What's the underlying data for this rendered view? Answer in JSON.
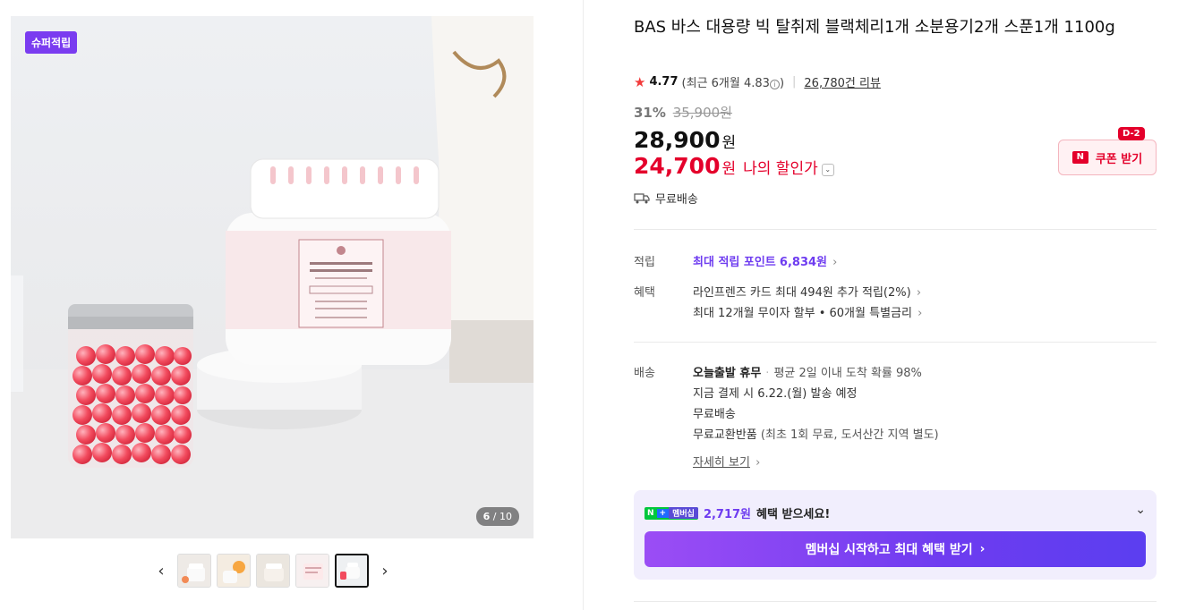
{
  "gallery": {
    "badge": "슈퍼적립",
    "counter_current": "6",
    "counter_total": "/ 10",
    "thumbs_count": 5,
    "prev_icon": "chevron-left-icon",
    "next_icon": "chevron-right-icon"
  },
  "product": {
    "title": "BAS 바스 대용량 빅 탈취제 블랙체리1개 소분용기2개 스푼1개 1100g",
    "rating": {
      "score": "4.77",
      "recent": "(최근 6개월 4.83",
      "recent_close": ")",
      "reviews": "26,780건 리뷰"
    },
    "discount_rate": "31%",
    "original_price": "35,900원",
    "price": "28,900",
    "price_unit": "원",
    "my_price": "24,700",
    "my_price_unit": "원",
    "my_price_label": "나의 할인가",
    "shipping": "무료배송"
  },
  "coupon": {
    "label": "쿠폰 받기",
    "dday": "D-2",
    "logo": "N"
  },
  "points": {
    "label": "적립",
    "text": "최대 적립 포인트",
    "amount": "6,834원"
  },
  "benefits": {
    "label": "혜택",
    "line1": "라인프렌즈 카드 최대 494원 추가 적립(2%)",
    "line2": "최대 12개월 무이자 할부 • 60개월 특별금리"
  },
  "delivery": {
    "label": "배송",
    "today_title": "오늘출발 휴무",
    "today_sub": "평균 2일 이내 도착 확률 98%",
    "schedule": "지금 결제 시 6.22.(월) 발송 예정",
    "free": "무료배송",
    "exchange": "무료교환반품",
    "exchange_sub": "(최초 1회 무료, 도서산간 지역 별도)",
    "more": "자세히 보기"
  },
  "membership": {
    "badge_n": "N",
    "badge_plus": "+",
    "badge_text": "멤버십",
    "amount": "2,717원",
    "text": "혜택 받으세요!",
    "button": "멤버십 시작하고 최대 혜택 받기"
  },
  "colors": {
    "accent_purple": "#6e3cf0",
    "price_red": "#e4002b",
    "super_badge": "#7a3cf0"
  }
}
